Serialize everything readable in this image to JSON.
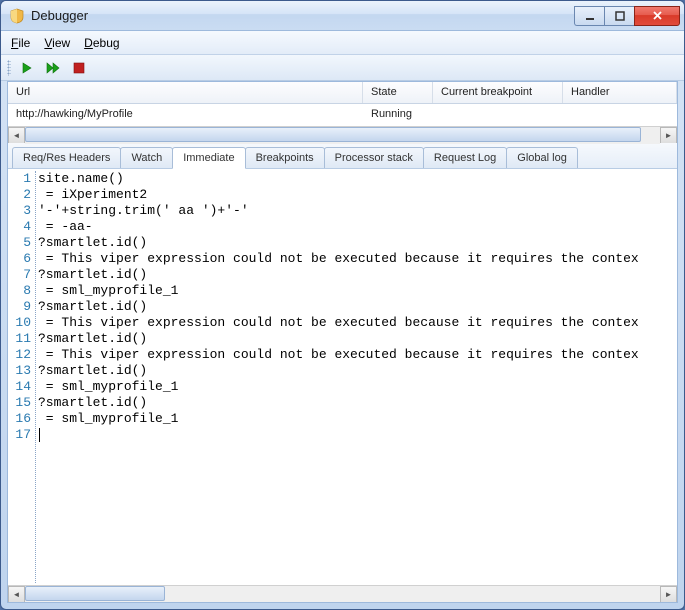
{
  "window": {
    "title": "Debugger"
  },
  "menu": {
    "file": "File",
    "view": "View",
    "debug": "Debug"
  },
  "grid": {
    "headers": {
      "url": "Url",
      "state": "State",
      "bp": "Current breakpoint",
      "handler": "Handler"
    },
    "row": {
      "url": "http://hawking/MyProfile",
      "state": "Running",
      "bp": "",
      "handler": ""
    }
  },
  "tabs": {
    "reqres": "Req/Res Headers",
    "watch": "Watch",
    "immediate": "Immediate",
    "breakpoints": "Breakpoints",
    "procstack": "Processor stack",
    "reqlog": "Request Log",
    "globallog": "Global log"
  },
  "code": {
    "lines": [
      "site.name()",
      " = iXperiment2",
      "'-'+string.trim(' aa ')+'-'",
      " = -aa-",
      "?smartlet.id()",
      " = This viper expression could not be executed because it requires the contex",
      "?smartlet.id()",
      " = sml_myprofile_1",
      "?smartlet.id()",
      " = This viper expression could not be executed because it requires the contex",
      "?smartlet.id()",
      " = This viper expression could not be executed because it requires the contex",
      "?smartlet.id()",
      " = sml_myprofile_1",
      "?smartlet.id()",
      " = sml_myprofile_1",
      ""
    ]
  }
}
